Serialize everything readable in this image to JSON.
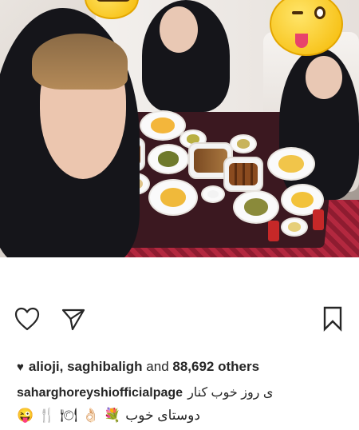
{
  "post": {
    "image_alt": "Group selfie at restaurant",
    "likes": {
      "usernames": "alioji, saghibaligh",
      "and_word": "and",
      "count": "88,692",
      "others_word": "others"
    },
    "caption": {
      "username": "saharghoreyshiofficialpage",
      "text_line1": "ی روز خوب کنار",
      "text_line2": "دوستای خوب",
      "emojis": [
        "😜",
        "🍴",
        "🍽",
        "👌🏻",
        "💐"
      ]
    }
  },
  "icons": {
    "like": "heart-outline-icon",
    "share": "paper-plane-icon",
    "save": "bookmark-icon",
    "likes_heart": "heart-filled-icon"
  },
  "colors": {
    "text": "#262626",
    "background": "#ffffff"
  }
}
